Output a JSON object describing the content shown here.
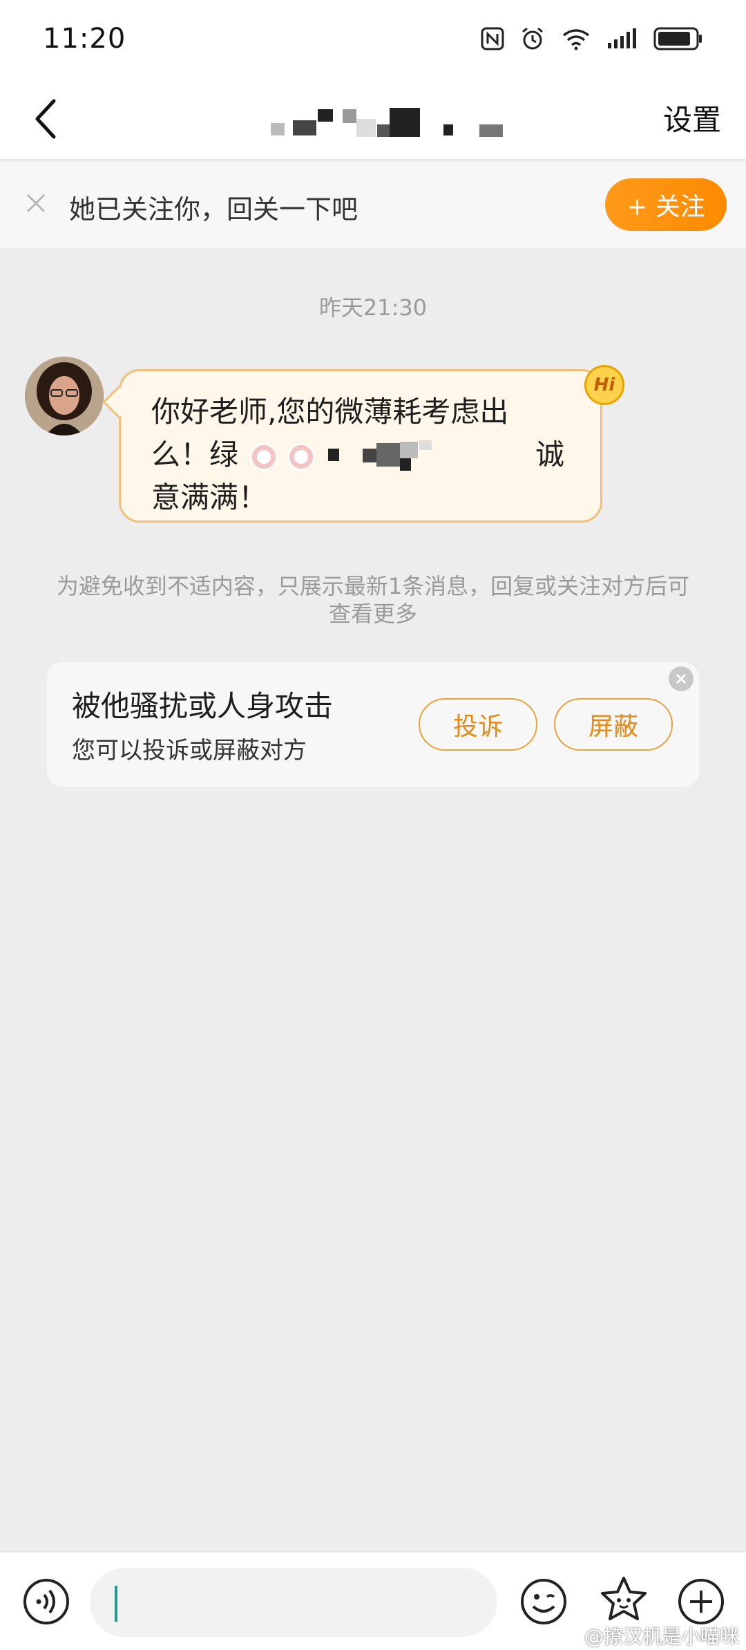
{
  "status_bar": {
    "time": "11:20"
  },
  "nav": {
    "back_icon": "chevron-left-icon",
    "settings_label": "设置"
  },
  "follow_banner": {
    "text": "她已关注你，回关一下吧",
    "follow_label": "+ 关注"
  },
  "chat": {
    "timestamp": "昨天21:30",
    "message_line1": "你好老师,您的微薄耗考虑出",
    "message_line2": "么！绿",
    "message_line2_tail": "诚",
    "message_line3": "意满满！",
    "badge": "Hi"
  },
  "notice": {
    "text": "为避免收到不适内容，只展示最新1条消息，回复或关注对方后可查看更多"
  },
  "report_card": {
    "title": "被他骚扰或人身攻击",
    "subtitle": "您可以投诉或屏蔽对方",
    "complain_label": "投诉",
    "block_label": "屏蔽"
  },
  "watermark": {
    "text": "@撩汉机是小喵咪"
  },
  "colors": {
    "accent": "#ff8a00",
    "bubble_border": "#f0c07a",
    "caret": "#1e9a86"
  }
}
